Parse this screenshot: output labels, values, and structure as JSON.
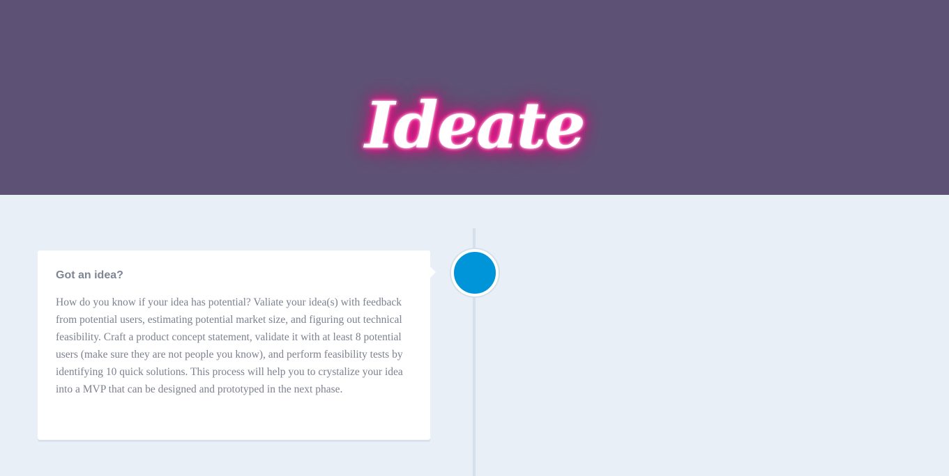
{
  "hero": {
    "title": "Ideate",
    "background_color": "#5d5275",
    "glow_color": "#ff1493"
  },
  "timeline": {
    "dot_color": "#0094d9",
    "items": [
      {
        "title": "Got an idea?",
        "body": "How do you know if your idea has potential? Valiate your idea(s) with feedback from potential users, estimating potential market size, and figuring out technical feasibility. Craft a product concept statement, validate it with at least 8 potential users (make sure they are not people you know), and perform feasibility tests by identifying 10 quick solutions. This process will help you to crystalize your idea into a MVP that can be designed and prototyped in the next phase."
      }
    ]
  }
}
